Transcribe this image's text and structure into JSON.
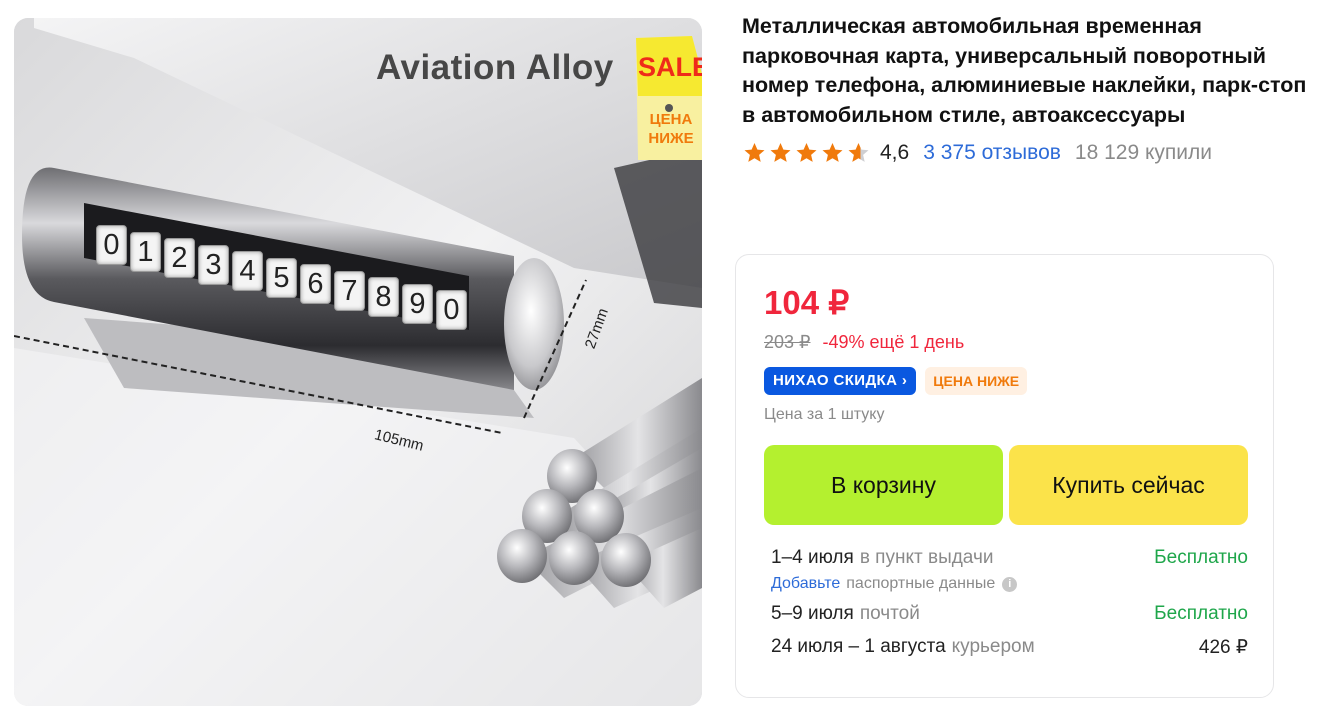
{
  "product_image": {
    "headline": "Aviation Alloy",
    "sale_tag": {
      "word": "SALE",
      "line1": "ЦЕНА",
      "line2": "НИЖЕ"
    },
    "digits": [
      "0",
      "1",
      "2",
      "3",
      "4",
      "5",
      "6",
      "7",
      "8",
      "9",
      "0"
    ],
    "dimension_length": "105mm",
    "dimension_height": "27mm"
  },
  "product": {
    "title": "Металлическая автомобильная временная парковочная карта, универсальный поворотный номер телефона, алюминиевые наклейки, парк-стоп в автомобильном стиле, автоаксессуары",
    "rating": "4,6",
    "rating_value": 4.6,
    "reviews": "3 375 отзывов",
    "bought": "18 129 купили"
  },
  "price_card": {
    "price": "104 ₽",
    "old_price": "203 ₽",
    "discount": "-49% ещё 1 день",
    "badge_discount": "НИХАО СКИДКА ›",
    "badge_low_price": "ЦЕНА НИЖЕ",
    "unit_note": "Цена за 1 штуку",
    "cart_button": "В корзину",
    "buy_button": "Купить сейчас",
    "delivery": [
      {
        "date": "1–4 июля",
        "method": "в пункт выдачи",
        "cost": "Бесплатно",
        "free": true
      },
      {
        "date": "5–9 июля",
        "method": "почтой",
        "cost": "Бесплатно",
        "free": true
      },
      {
        "date": "24 июля – 1 августа",
        "method": "курьером",
        "cost": "426 ₽",
        "free": false
      }
    ],
    "passport_link": "Добавьте",
    "passport_text": "паспортные данные"
  },
  "colors": {
    "price_red": "#f0263c",
    "link_blue": "#2d6bd8",
    "free_green": "#1ea64a",
    "cart_green": "#b4f02f",
    "buy_yellow": "#fbe34a",
    "badge_blue": "#0a58e0",
    "star_orange": "#f07a0c"
  },
  "icons": {
    "star": "star-icon",
    "info": "info-icon"
  }
}
